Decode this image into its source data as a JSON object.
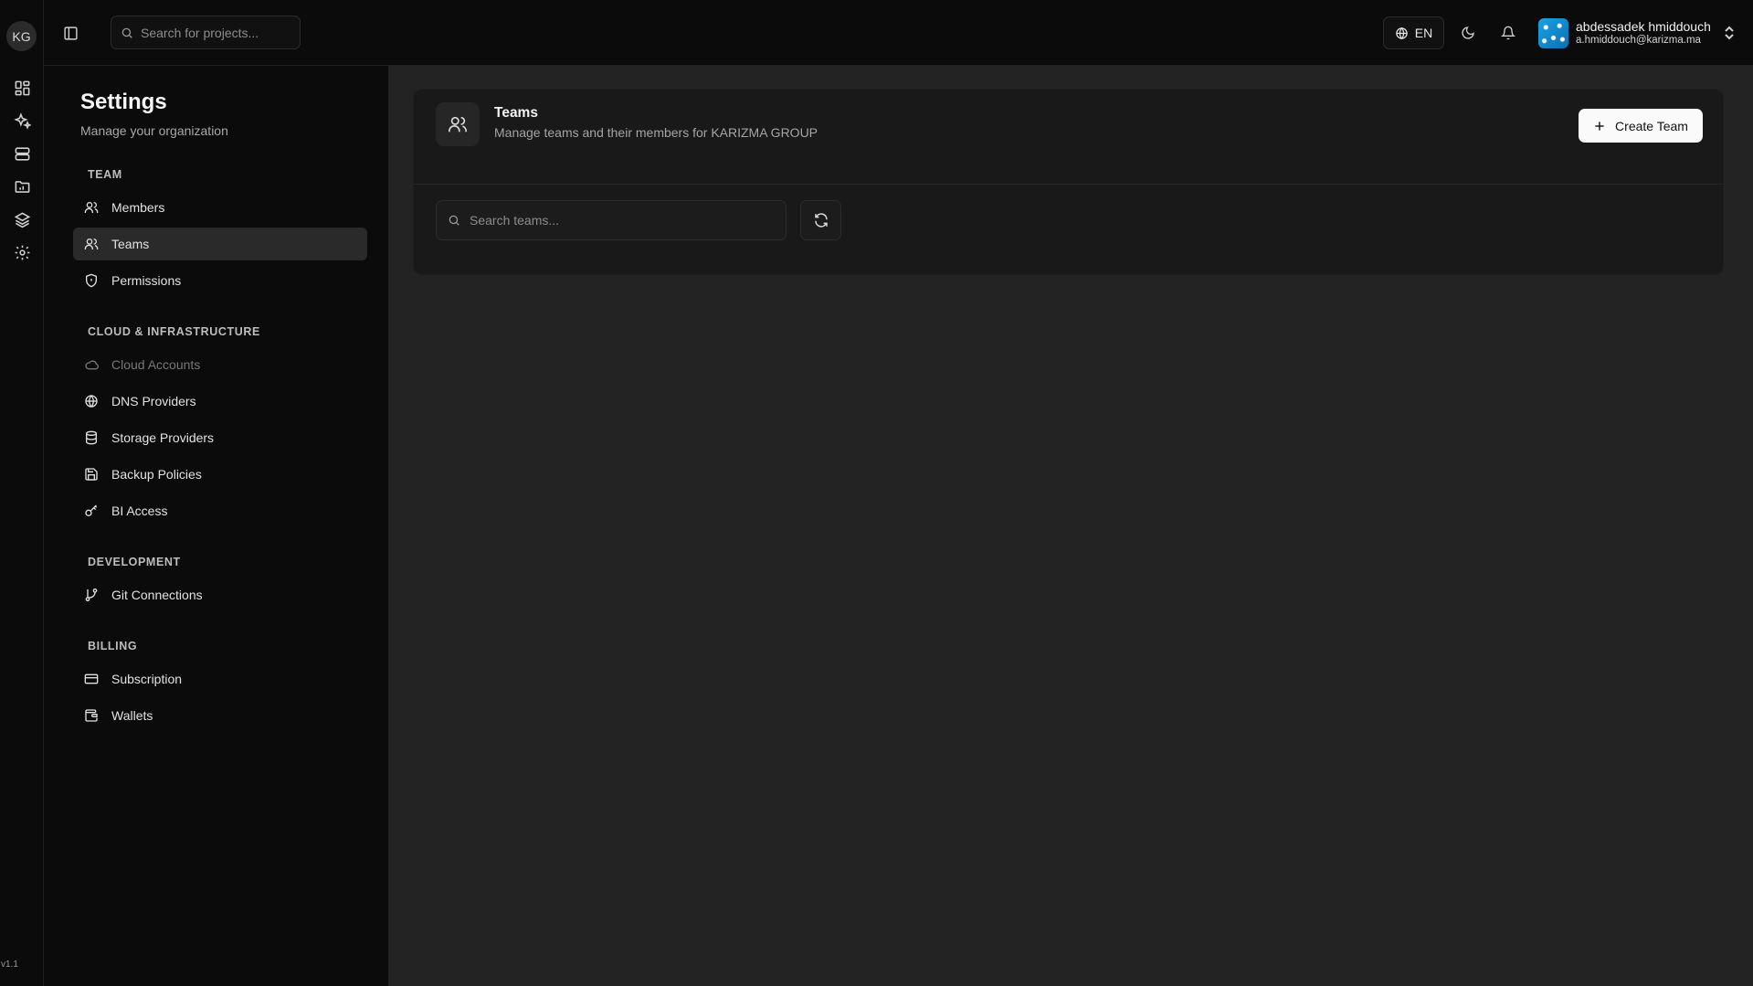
{
  "app": {
    "org_initials": "KG",
    "version": "v1.1"
  },
  "rail": {
    "items": [
      {
        "icon": "dashboard-grid-icon"
      },
      {
        "icon": "sparkles-icon"
      },
      {
        "icon": "server-icon"
      },
      {
        "icon": "folder-chart-icon"
      },
      {
        "icon": "layers-icon"
      },
      {
        "icon": "gear-icon"
      }
    ]
  },
  "topbar": {
    "search_placeholder": "Search for projects...",
    "language": "EN",
    "user": {
      "name": "abdessadek hmiddouch",
      "email": "a.hmiddouch@karizma.ma"
    }
  },
  "sidebar": {
    "title": "Settings",
    "subtitle": "Manage your organization",
    "groups": [
      {
        "label": "TEAM",
        "items": [
          {
            "label": "Members",
            "icon": "users-icon"
          },
          {
            "label": "Teams",
            "icon": "user-group-icon",
            "active": true
          },
          {
            "label": "Permissions",
            "icon": "shield-icon"
          }
        ]
      },
      {
        "label": "CLOUD & INFRASTRUCTURE",
        "items": [
          {
            "label": "Cloud Accounts",
            "icon": "cloud-icon",
            "disabled": true
          },
          {
            "label": "DNS Providers",
            "icon": "globe-icon"
          },
          {
            "label": "Storage Providers",
            "icon": "database-icon"
          },
          {
            "label": "Backup Policies",
            "icon": "save-icon"
          },
          {
            "label": "BI Access",
            "icon": "key-icon"
          }
        ]
      },
      {
        "label": "DEVELOPMENT",
        "items": [
          {
            "label": "Git Connections",
            "icon": "git-branch-icon"
          }
        ]
      },
      {
        "label": "BILLING",
        "items": [
          {
            "label": "Subscription",
            "icon": "credit-card-icon"
          },
          {
            "label": "Wallets",
            "icon": "wallet-icon"
          }
        ]
      }
    ]
  },
  "main": {
    "title": "Teams",
    "description": "Manage teams and their members for KARIZMA GROUP",
    "create_button": "Create Team",
    "search_placeholder": "Search teams..."
  }
}
